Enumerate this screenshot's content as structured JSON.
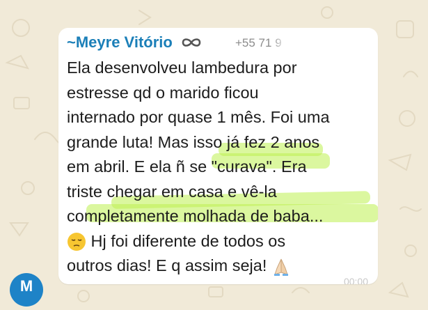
{
  "chat": {
    "sender_name": "~Meyre Vitório",
    "sender_phone": "+55 71 9",
    "avatar_initial": "M",
    "message_lines": [
      "Ela desenvolveu lambedura por",
      "estresse qd o marido ficou",
      "internado por quase 1 mês. Foi uma",
      "grande luta! Mas isso já fez 2 anos",
      "em abril. E ela ñ se \"curava\". Era",
      "triste chegar em casa e vê-la",
      "completamente molhada de baba...",
      " Hj foi diferente de todos os",
      "outros dias! E q assim seja! "
    ],
    "message_time": "00:00",
    "colors": {
      "sender": "#1b7fb8",
      "highlight": "#bef050",
      "background": "#f1ead8",
      "avatar": "#1e83c7"
    },
    "icons": [
      "infinity-icon",
      "pensive-face-emoji",
      "praying-hands-emoji"
    ]
  }
}
